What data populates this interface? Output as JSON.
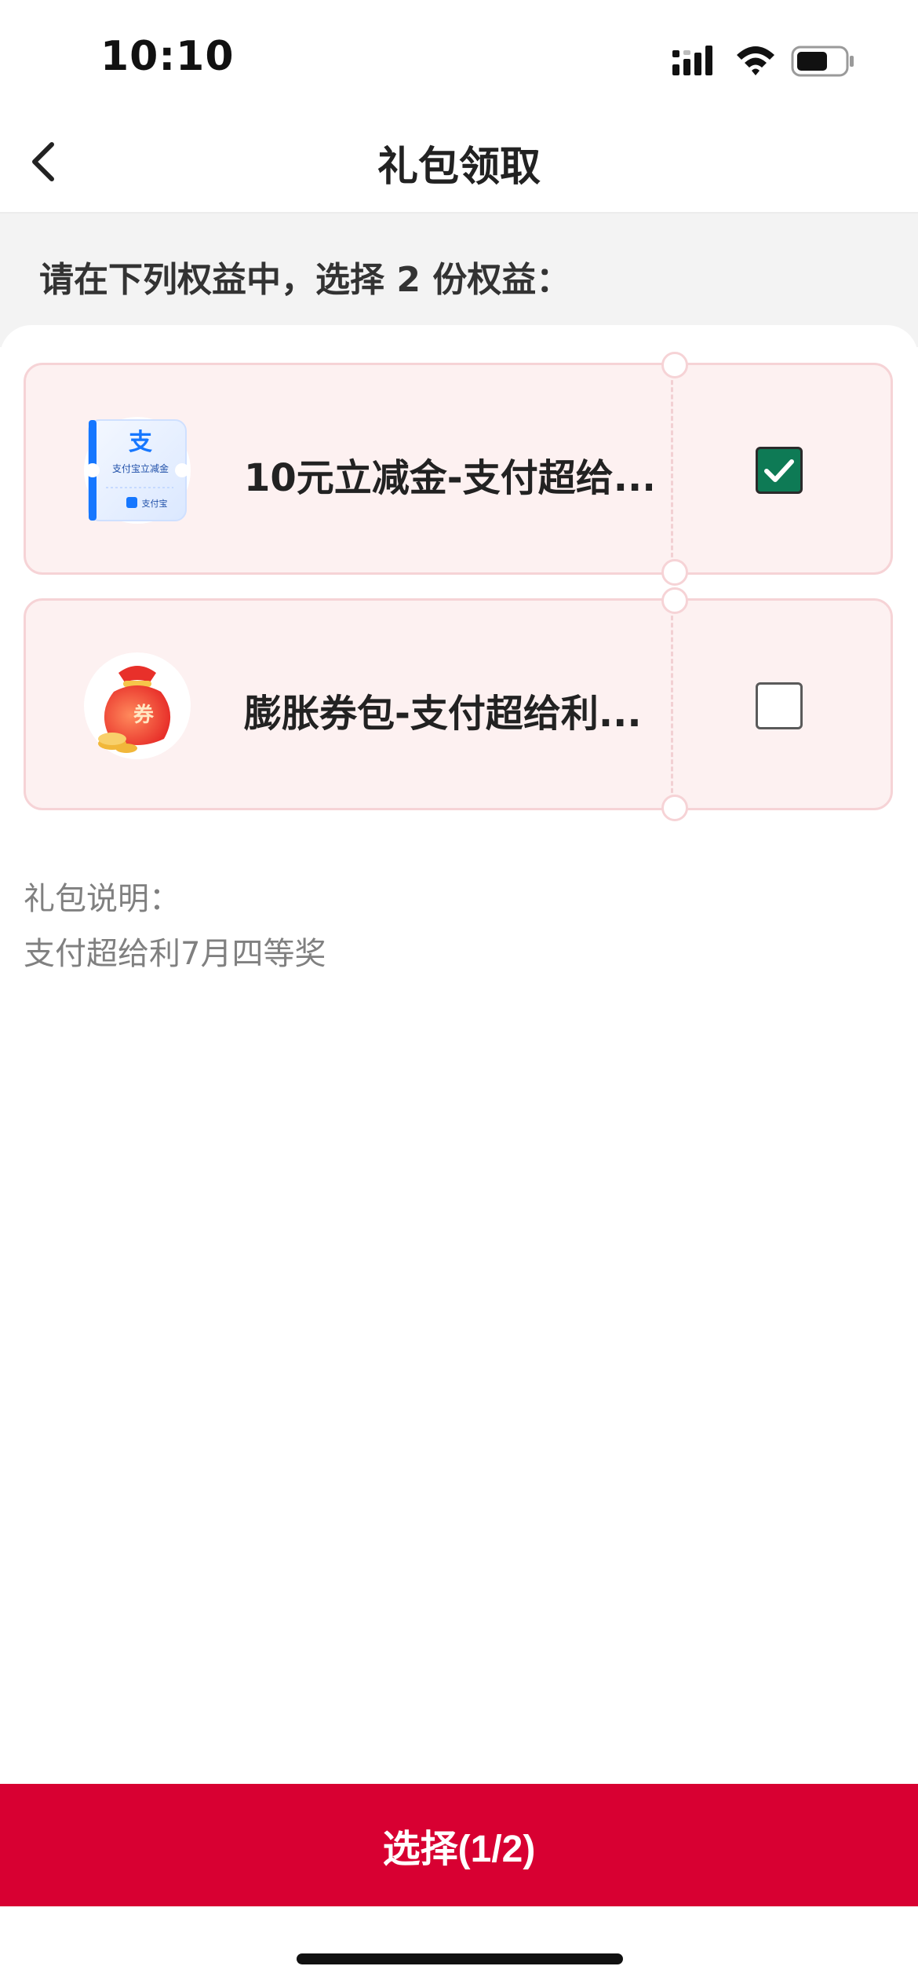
{
  "status_bar": {
    "time": "10:10",
    "icons": [
      "cellular-signal-icon",
      "wifi-icon",
      "battery-icon"
    ]
  },
  "nav": {
    "back_icon": "chevron-left-icon",
    "title": "礼包领取"
  },
  "instruction": "请在下列权益中，选择 2 份权益：",
  "benefits": [
    {
      "name": "10元立减金-支付超给...",
      "icon": "alipay-discount-voucher-icon",
      "icon_text": "支付宝立减金",
      "icon_badge": "支付宝",
      "checked": true
    },
    {
      "name": "膨胀券包-支付超给利...",
      "icon": "coupon-lucky-bag-icon",
      "icon_text": "券",
      "checked": false
    }
  ],
  "description": {
    "label": "礼包说明：",
    "text": "支付超给利7月四等奖"
  },
  "select_button": {
    "label": "选择(1/2)"
  },
  "colors": {
    "accent": "#d80032",
    "checked": "#0e7a55",
    "card_bg": "#fdf1f1",
    "card_border": "#f6d3d6"
  }
}
